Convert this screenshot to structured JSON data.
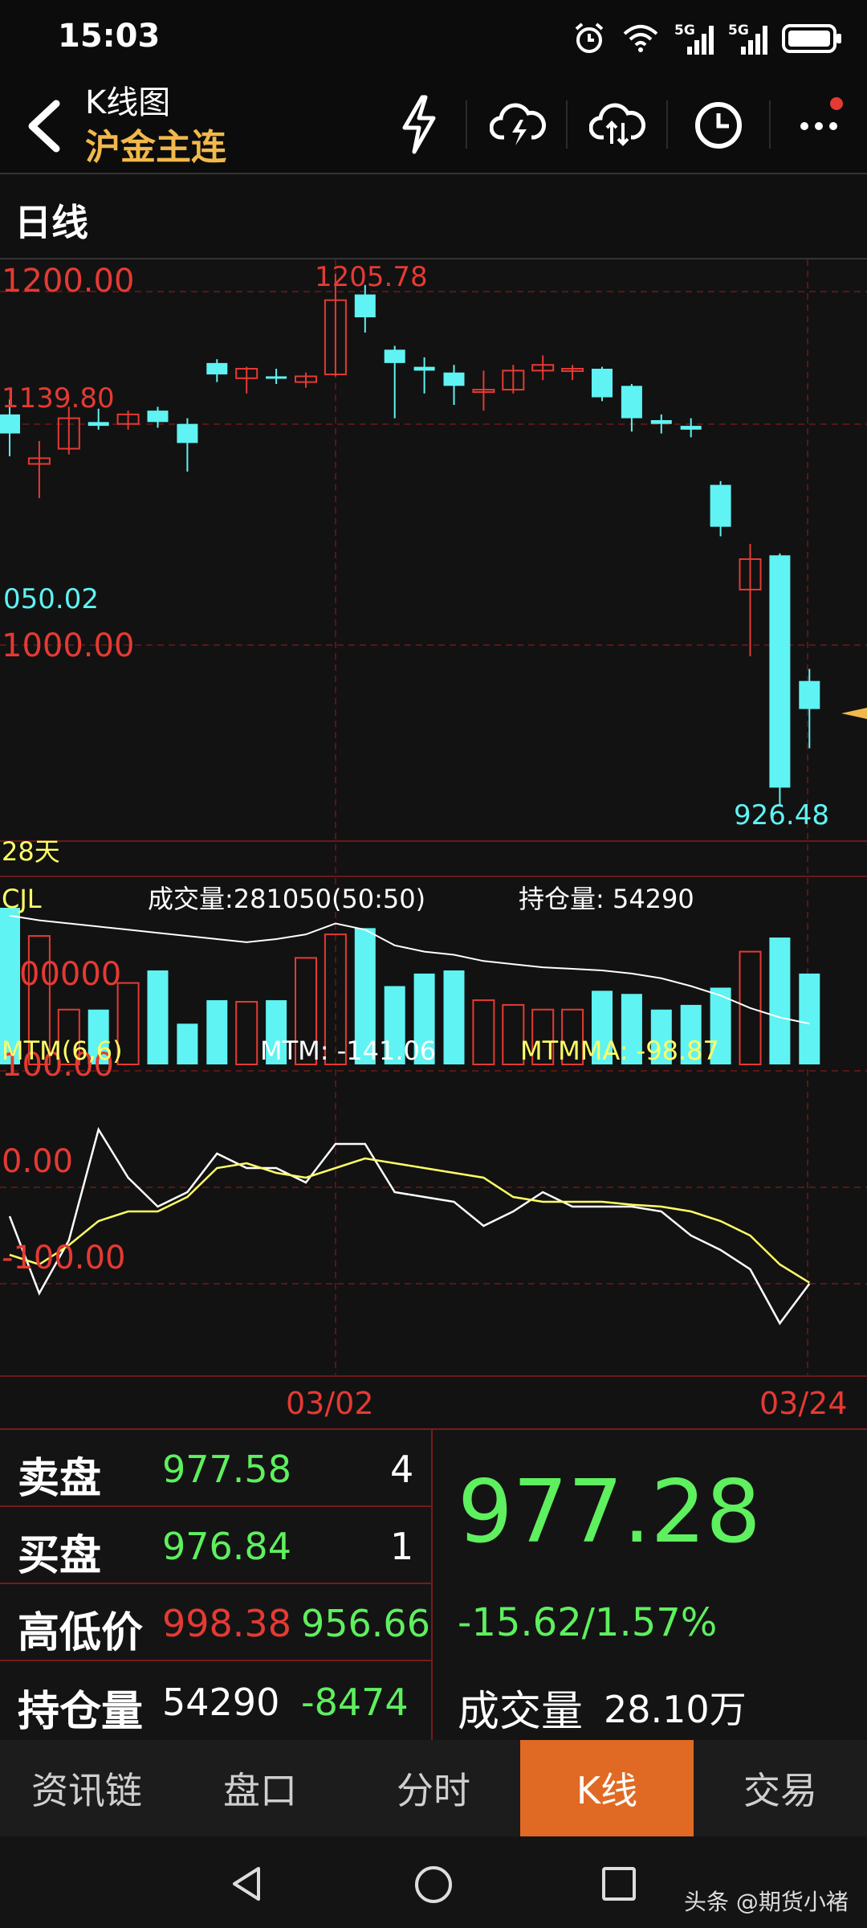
{
  "status_bar": {
    "time": "15:03",
    "network1": "5G",
    "network2": "5G"
  },
  "header": {
    "title": "K线图",
    "subtitle": "沪金主连"
  },
  "period": {
    "label": "日线"
  },
  "chart": {
    "price_labels": {
      "top": "1200.00",
      "mid": "1139.80",
      "low_left": "050.02",
      "bottom": "1000.00",
      "peak": "1205.78",
      "trough": "926.48"
    },
    "days_label": "28天",
    "volume": {
      "label": "CJL",
      "summary": "成交量:281050(50:50)",
      "oi": "持仓量: 54290",
      "axis_label": "00000"
    },
    "mtm": {
      "label": "MTM(6,6)",
      "value": "MTM: -141.06",
      "ma": "MTMMA: -98.87",
      "top_label": "100.00",
      "mid_label": "0.00",
      "low_label": "-100.00"
    },
    "dates": [
      "03/02",
      "03/24"
    ]
  },
  "quote": {
    "ask_label": "卖盘",
    "ask_price": "977.58",
    "ask_qty": "4",
    "bid_label": "买盘",
    "bid_price": "976.84",
    "bid_qty": "1",
    "hl_label": "高低价",
    "high": "998.38",
    "low": "956.66",
    "oi_label": "持仓量",
    "oi": "54290",
    "oi_change": "-8474",
    "last_price": "977.28",
    "change": "-15.62/1.57%",
    "volume_label": "成交量",
    "volume": "28.10万"
  },
  "tabs": [
    "资讯链",
    "盘口",
    "分时",
    "K线",
    "交易"
  ],
  "watermark": "头条 @期货小褚",
  "colors": {
    "up": "#e53a33",
    "down": "#5ff3f3",
    "price_green": "#5ef05e",
    "active_tab": "#e06a24",
    "yellow": "#ffff66"
  },
  "chart_data": {
    "type": "candlestick",
    "candles": [
      {
        "o": 1132,
        "h": 1139.8,
        "l": 1110,
        "c": 1122
      },
      {
        "o": 1106,
        "h": 1118,
        "l": 1088,
        "c": 1109
      },
      {
        "o": 1114,
        "h": 1136,
        "l": 1111,
        "c": 1130
      },
      {
        "o": 1128,
        "h": 1135,
        "l": 1124,
        "c": 1126
      },
      {
        "o": 1127,
        "h": 1134,
        "l": 1124,
        "c": 1132
      },
      {
        "o": 1134,
        "h": 1136,
        "l": 1125,
        "c": 1128
      },
      {
        "o": 1127,
        "h": 1130,
        "l": 1102,
        "c": 1117
      },
      {
        "o": 1159,
        "h": 1161,
        "l": 1149,
        "c": 1153
      },
      {
        "o": 1151,
        "h": 1157,
        "l": 1143,
        "c": 1156
      },
      {
        "o": 1152,
        "h": 1156,
        "l": 1148,
        "c": 1151
      },
      {
        "o": 1149,
        "h": 1154,
        "l": 1146,
        "c": 1152
      },
      {
        "o": 1153,
        "h": 1205.78,
        "l": 1152,
        "c": 1192
      },
      {
        "o": 1195,
        "h": 1200,
        "l": 1175,
        "c": 1183
      },
      {
        "o": 1166,
        "h": 1168,
        "l": 1130,
        "c": 1159
      },
      {
        "o": 1157,
        "h": 1162,
        "l": 1143,
        "c": 1155
      },
      {
        "o": 1154,
        "h": 1158,
        "l": 1137,
        "c": 1147
      },
      {
        "o": 1144,
        "h": 1155,
        "l": 1134,
        "c": 1145
      },
      {
        "o": 1145,
        "h": 1158,
        "l": 1143,
        "c": 1155
      },
      {
        "o": 1155,
        "h": 1163,
        "l": 1150,
        "c": 1158
      },
      {
        "o": 1155,
        "h": 1158,
        "l": 1150,
        "c": 1156
      },
      {
        "o": 1156,
        "h": 1157,
        "l": 1139,
        "c": 1141
      },
      {
        "o": 1147,
        "h": 1148,
        "l": 1123,
        "c": 1130
      },
      {
        "o": 1129,
        "h": 1132,
        "l": 1122,
        "c": 1127
      },
      {
        "o": 1126,
        "h": 1130,
        "l": 1120,
        "c": 1124
      },
      {
        "o": 1095,
        "h": 1097,
        "l": 1068,
        "c": 1073
      },
      {
        "o": 1040,
        "h": 1064,
        "l": 1005,
        "c": 1056
      },
      {
        "o": 1058,
        "h": 1059,
        "l": 926.48,
        "c": 936
      },
      {
        "o": 992,
        "h": 998.38,
        "l": 956.66,
        "c": 977.28
      }
    ],
    "volume": [
      1.0,
      0.82,
      0.35,
      0.35,
      0.52,
      0.6,
      0.26,
      0.41,
      0.4,
      0.41,
      0.68,
      0.83,
      0.87,
      0.5,
      0.58,
      0.6,
      0.41,
      0.38,
      0.35,
      0.35,
      0.47,
      0.45,
      0.35,
      0.38,
      0.49,
      0.72,
      0.81,
      0.58
    ],
    "mtm": [
      -30,
      -110,
      -55,
      60,
      10,
      -20,
      -5,
      35,
      20,
      20,
      5,
      45,
      45,
      -5,
      -10,
      -15,
      -40,
      -25,
      -5,
      -20,
      -20,
      -20,
      -25,
      -50,
      -65,
      -85,
      -141.06,
      -100
    ],
    "mtmma": [
      -70,
      -80,
      -60,
      -35,
      -25,
      -25,
      -10,
      20,
      25,
      15,
      10,
      20,
      30,
      25,
      20,
      15,
      10,
      -10,
      -15,
      -15,
      -15,
      -18,
      -20,
      -25,
      -35,
      -50,
      -80,
      -98.87
    ]
  }
}
